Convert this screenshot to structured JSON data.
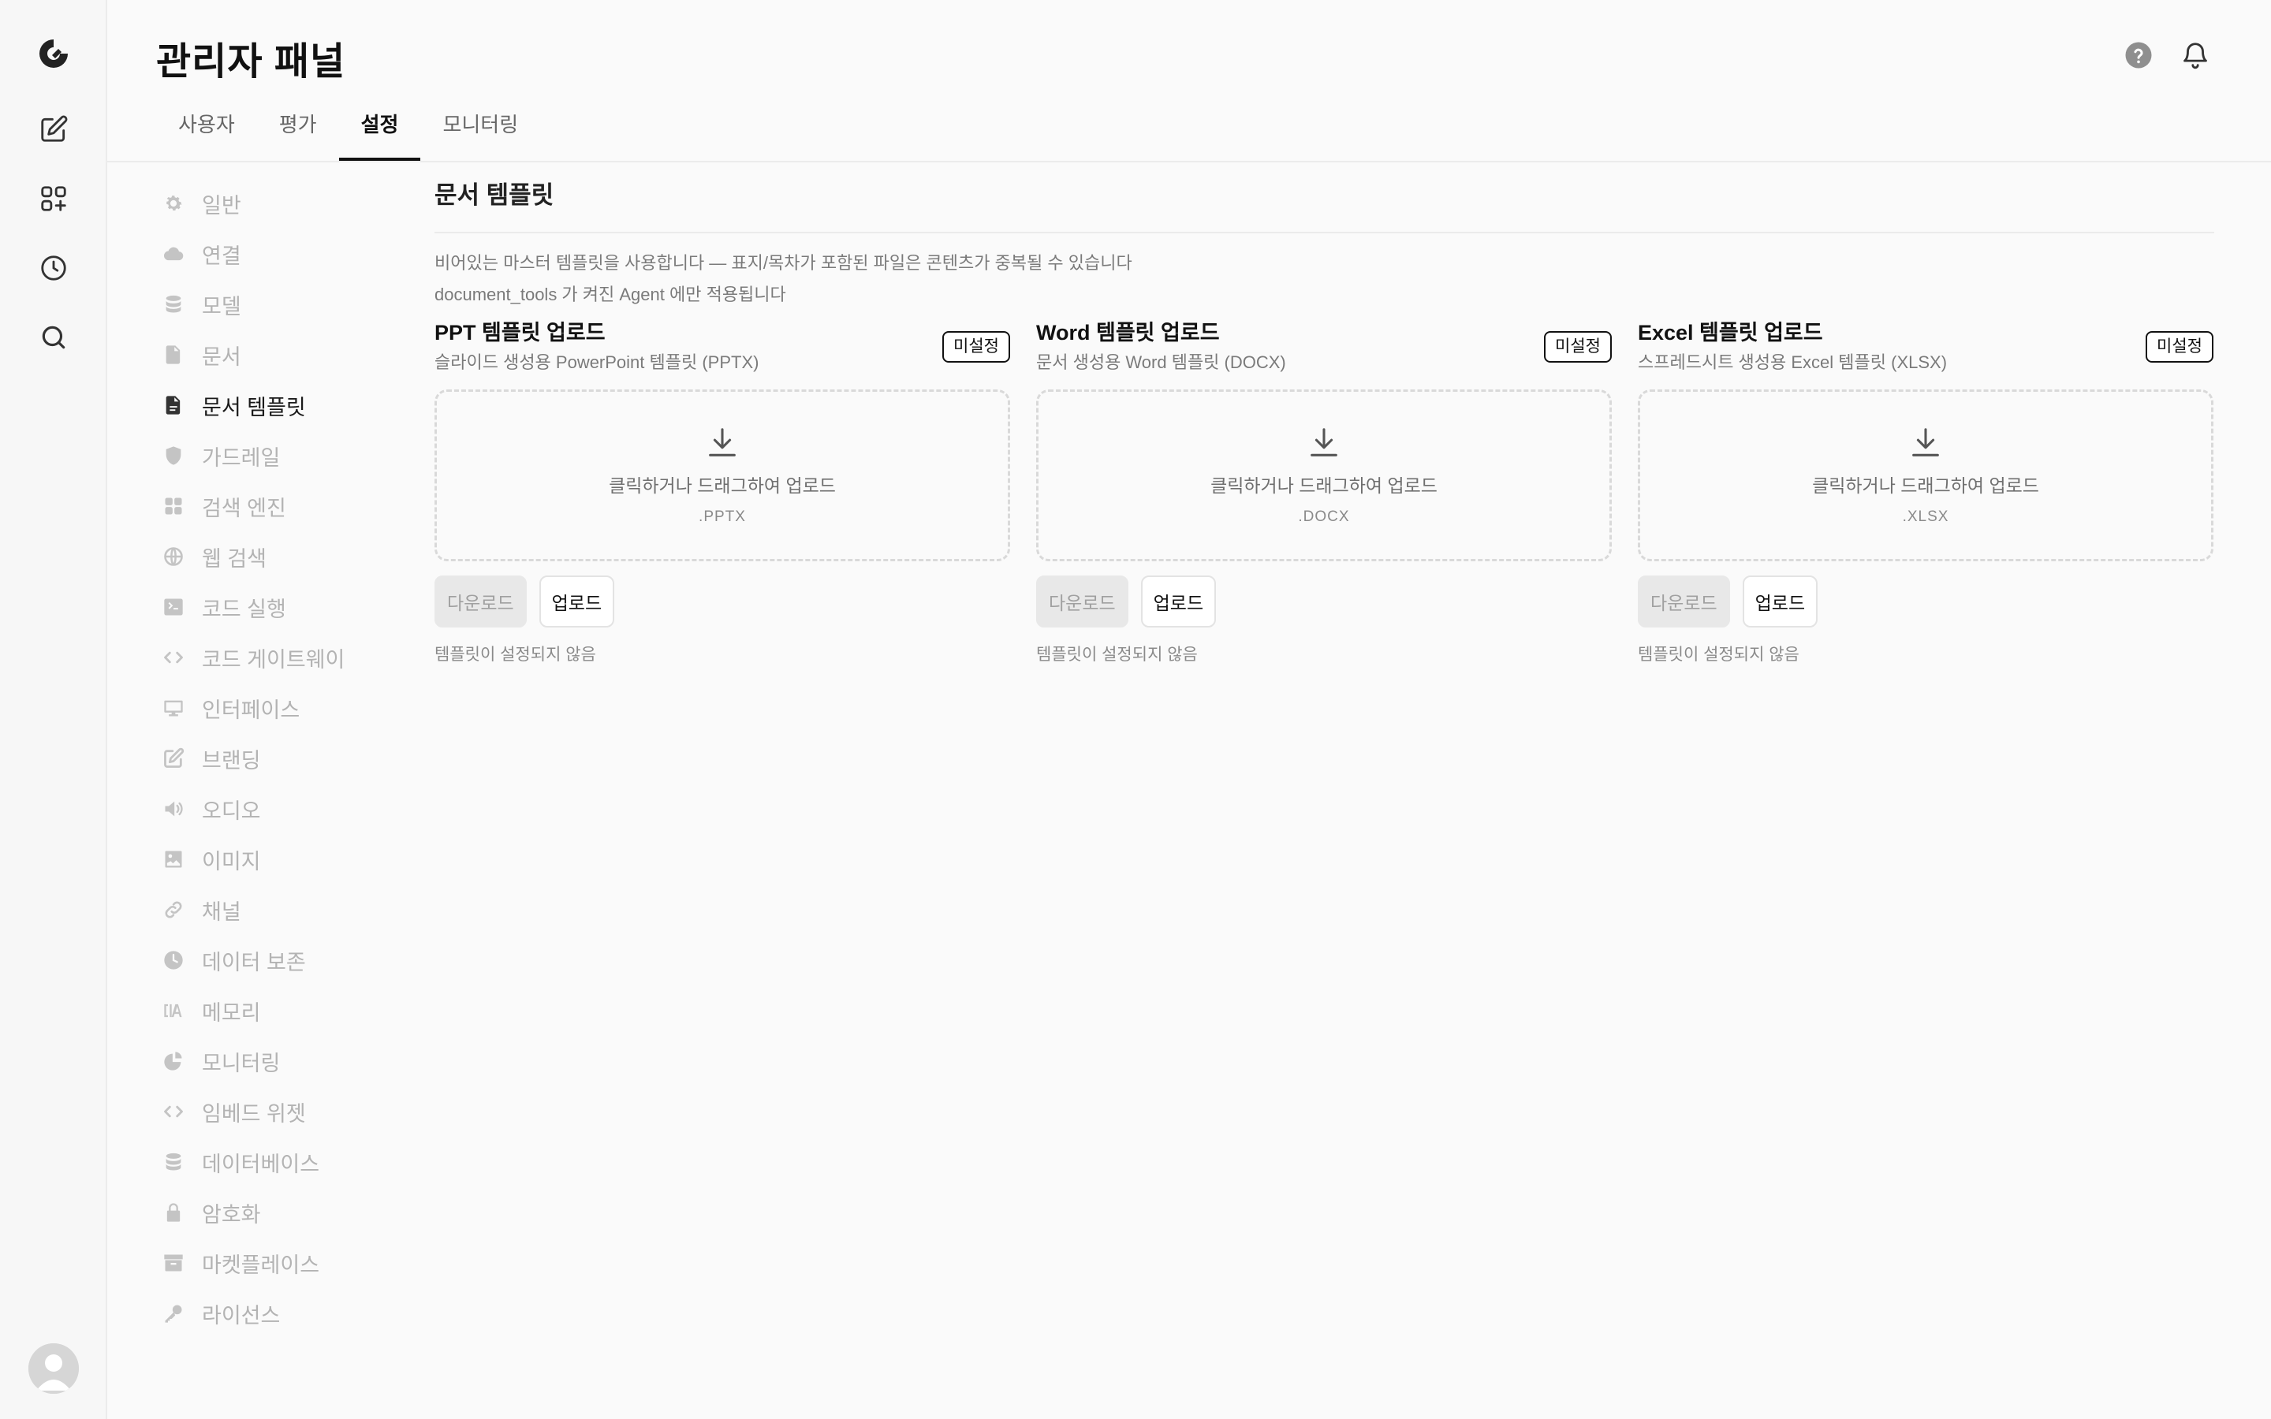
{
  "header": {
    "title": "관리자 패널",
    "help_icon": "help-circle-icon",
    "notification_icon": "bell-icon"
  },
  "tabs": [
    {
      "label": "사용자",
      "active": false
    },
    {
      "label": "평가",
      "active": false
    },
    {
      "label": "설정",
      "active": true
    },
    {
      "label": "모니터링",
      "active": false
    }
  ],
  "rail": {
    "items": [
      "logo-icon",
      "new-chat-icon",
      "workspace-icon",
      "history-icon",
      "search-icon"
    ],
    "avatar": "user-avatar"
  },
  "settings_nav": [
    {
      "label": "일반",
      "icon": "gear-icon",
      "active": false
    },
    {
      "label": "연결",
      "icon": "cloud-icon",
      "active": false
    },
    {
      "label": "모델",
      "icon": "database-icon",
      "active": false
    },
    {
      "label": "문서",
      "icon": "document-icon",
      "active": false
    },
    {
      "label": "문서 템플릿",
      "icon": "document-template-icon",
      "active": true
    },
    {
      "label": "가드레일",
      "icon": "shield-icon",
      "active": false
    },
    {
      "label": "검색 엔진",
      "icon": "grid-icon",
      "active": false
    },
    {
      "label": "웹 검색",
      "icon": "globe-icon",
      "active": false
    },
    {
      "label": "코드 실행",
      "icon": "terminal-icon",
      "active": false
    },
    {
      "label": "코드 게이트웨이",
      "icon": "code-icon",
      "active": false
    },
    {
      "label": "인터페이스",
      "icon": "monitor-icon",
      "active": false
    },
    {
      "label": "브랜딩",
      "icon": "edit-icon",
      "active": false
    },
    {
      "label": "오디오",
      "icon": "speaker-icon",
      "active": false
    },
    {
      "label": "이미지",
      "icon": "image-icon",
      "active": false
    },
    {
      "label": "채널",
      "icon": "link-icon",
      "active": false
    },
    {
      "label": "데이터 보존",
      "icon": "clock-icon",
      "active": false
    },
    {
      "label": "메모리",
      "icon": "memory-icon",
      "active": false
    },
    {
      "label": "모니터링",
      "icon": "chart-icon",
      "active": false
    },
    {
      "label": "임베드 위젯",
      "icon": "embed-code-icon",
      "active": false
    },
    {
      "label": "데이터베이스",
      "icon": "database-icon",
      "active": false
    },
    {
      "label": "암호화",
      "icon": "lock-icon",
      "active": false
    },
    {
      "label": "마켓플레이스",
      "icon": "archive-icon",
      "active": false
    },
    {
      "label": "라이선스",
      "icon": "key-icon",
      "active": false
    }
  ],
  "section": {
    "title": "문서 템플릿",
    "desc1": "비어있는 마스터 템플릿을 사용합니다 — 표지/목차가 포함된 파일은 콘텐츠가 중복될 수 있습니다",
    "desc2": "document_tools 가 켜진 Agent 에만 적용됩니다"
  },
  "cards": [
    {
      "title": "PPT 템플릿 업로드",
      "subtitle": "슬라이드 생성용 PowerPoint 템플릿 (PPTX)",
      "badge": "미설정",
      "drop_text": "클릭하거나 드래그하여 업로드",
      "ext": ".PPTX",
      "download_label": "다운로드",
      "upload_label": "업로드",
      "status": "템플릿이 설정되지 않음"
    },
    {
      "title": "Word 템플릿 업로드",
      "subtitle": "문서 생성용 Word 템플릿 (DOCX)",
      "badge": "미설정",
      "drop_text": "클릭하거나 드래그하여 업로드",
      "ext": ".DOCX",
      "download_label": "다운로드",
      "upload_label": "업로드",
      "status": "템플릿이 설정되지 않음"
    },
    {
      "title": "Excel 템플릿 업로드",
      "subtitle": "스프레드시트 생성용 Excel 템플릿 (XLSX)",
      "badge": "미설정",
      "drop_text": "클릭하거나 드래그하여 업로드",
      "ext": ".XLSX",
      "download_label": "다운로드",
      "upload_label": "업로드",
      "status": "템플릿이 설정되지 않음"
    }
  ]
}
